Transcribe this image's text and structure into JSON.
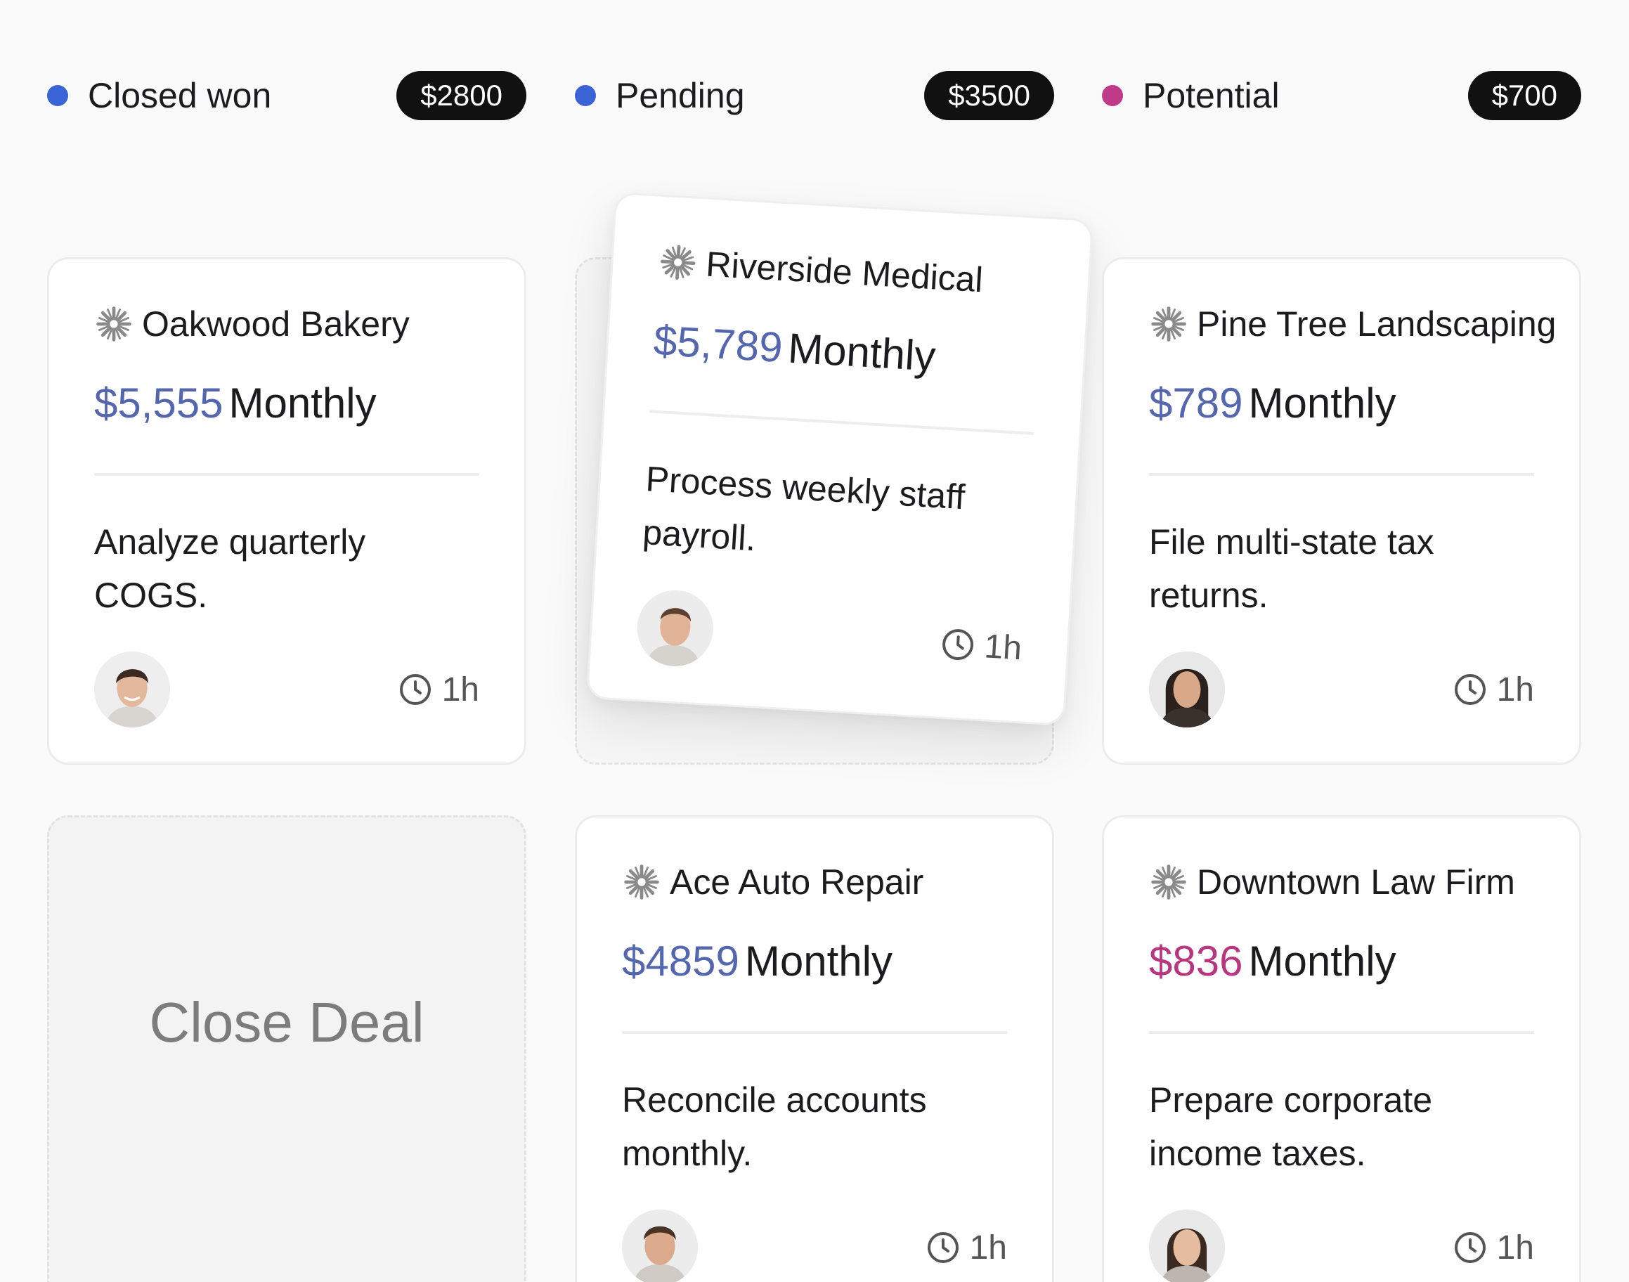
{
  "columns": [
    {
      "title": "Closed won",
      "total": "$2800",
      "dot_color": "#3a63d6"
    },
    {
      "title": "Pending",
      "total": "$3500",
      "dot_color": "#3a63d6"
    },
    {
      "title": "Potential",
      "total": "$700",
      "dot_color": "#c03a8a"
    }
  ],
  "cards": [
    {
      "company": "Oakwood Bakery",
      "amount": "$5,555",
      "period": "Monthly",
      "task": "Analyze quarterly COGS.",
      "time": "1h",
      "amount_color": "#5467ae"
    },
    {
      "company": "Riverside Medical",
      "amount": "$5,789",
      "period": "Monthly",
      "task": "Process weekly staff payroll.",
      "time": "1h",
      "amount_color": "#5467ae"
    },
    {
      "company": "Pine Tree Landscaping",
      "amount": "$789",
      "period": "Monthly",
      "task": "File multi-state tax returns.",
      "time": "1h",
      "amount_color": "#5467ae"
    },
    {
      "company": "Ace Auto Repair",
      "amount": "$4859",
      "period": "Monthly",
      "task": "Reconcile accounts monthly.",
      "time": "1h",
      "amount_color": "#5467ae"
    },
    {
      "company": "Downtown Law Firm",
      "amount": "$836",
      "period": "Monthly",
      "task": "Prepare corporate income taxes.",
      "time": "1h",
      "amount_color": "#b8367e"
    }
  ],
  "drop_zone": {
    "label": "Close Deal"
  },
  "icons": {
    "company": "sparkle-logo-icon",
    "time": "clock-icon"
  }
}
